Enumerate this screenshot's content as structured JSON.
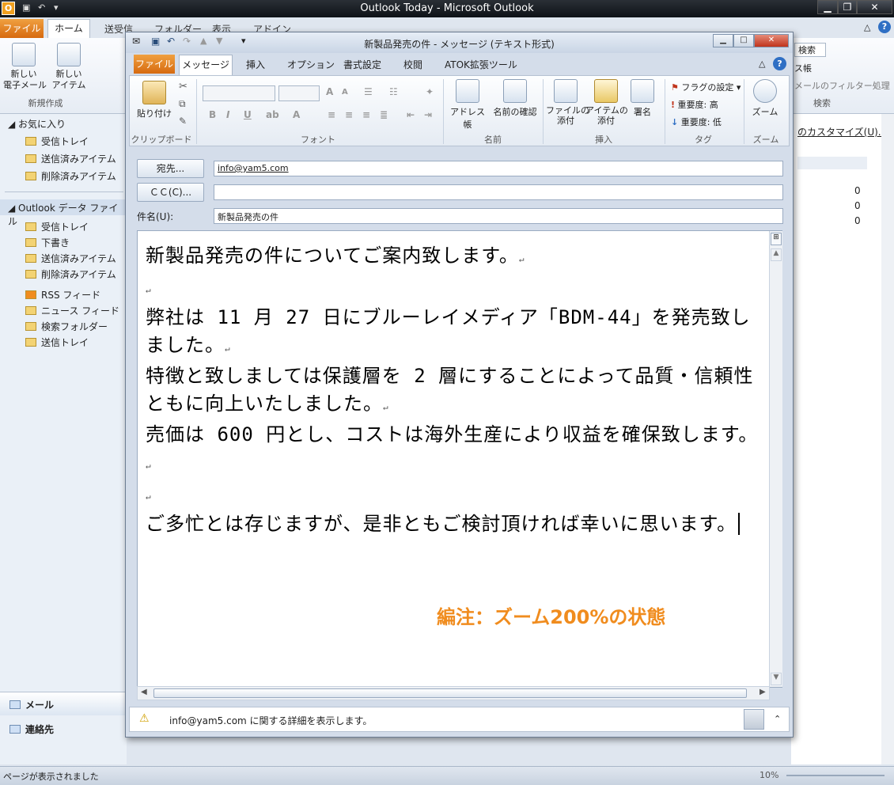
{
  "main": {
    "title": "Outlook Today - Microsoft Outlook",
    "tabs": [
      "ファイル",
      "ホーム",
      "送受信",
      "フォルダー",
      "表示",
      "アドイン"
    ],
    "ribbon": {
      "new_mail": "新しい\n電子メール",
      "new_item": "新しい\nアイテム",
      "group_new": "新規作成",
      "group_search": "検索",
      "search_label": "検索",
      "address_book": "ス帳",
      "filter": "メールのフィルター処理"
    },
    "customize": "のカスタマイズ(U)...",
    "counts": [
      "0",
      "0",
      "0"
    ]
  },
  "leftnav": {
    "favorites_header": "お気に入り",
    "favorites": [
      "受信トレイ",
      "送信済みアイテム",
      "削除済みアイテム"
    ],
    "datafile_header": "Outlook データ ファイル",
    "datafile": [
      "受信トレイ",
      "下書き",
      "送信済みアイテム",
      "削除済みアイテム"
    ],
    "others": [
      "RSS フィード",
      "ニュース フィード",
      "検索フォルダー",
      "送信トレイ"
    ],
    "mail": "メール",
    "contacts": "連絡先"
  },
  "statusbar": {
    "text": "ページが表示されました",
    "zoom": "10%"
  },
  "compose": {
    "title": "新製品発売の件 - メッセージ (テキスト形式)",
    "tabs": [
      "ファイル",
      "メッセージ",
      "挿入",
      "オプション",
      "書式設定",
      "校閲",
      "ATOK拡張ツール"
    ],
    "ribbon": {
      "paste": "貼り付け",
      "clipboard": "クリップボード",
      "font": "フォント",
      "address_book": "アドレス帳",
      "check_names": "名前の確認",
      "names": "名前",
      "attach_file": "ファイルの\n添付",
      "attach_item": "アイテムの\n添付",
      "signature": "署名",
      "include": "挿入",
      "flag": "フラグの設定",
      "high": "重要度: 高",
      "low": "重要度: 低",
      "tags": "タグ",
      "zoom": "ズーム",
      "zoom_group": "ズーム"
    },
    "to_button": "宛先...",
    "cc_button": "ＣＣ(C)...",
    "subject_label": "件名(U):",
    "to_value": "info@yam5.com",
    "cc_value": "",
    "subject_value": "新製品発売の件",
    "body_lines": [
      "新製品発売の件についてご案内致します。",
      "",
      "弊社は 11 月 27 日にブルーレイメディア「BDM-44」を発売致しました。",
      "特徴と致しましては保護層を 2 層にすることによって品質・信頼性ともに向上いたしました。",
      "売価は 600 円とし、コストは海外生産により収益を確保致します。",
      "",
      "ご多忙とは存じますが、是非ともご検討頂ければ幸いに思います。"
    ],
    "note": "編注：ズーム200%の状態",
    "people_pane": "info@yam5.com に関する詳細を表示します。"
  },
  "colors": {
    "accent_orange": "#f08c1e",
    "file_tab": "#e07a1a",
    "titlebar": "#1b2027"
  }
}
